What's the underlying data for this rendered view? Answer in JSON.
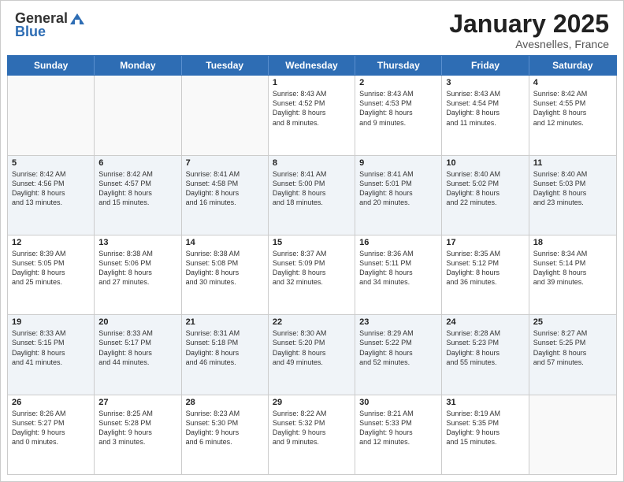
{
  "header": {
    "logo_general": "General",
    "logo_blue": "Blue",
    "month_title": "January 2025",
    "subtitle": "Avesnelles, France"
  },
  "days_of_week": [
    "Sunday",
    "Monday",
    "Tuesday",
    "Wednesday",
    "Thursday",
    "Friday",
    "Saturday"
  ],
  "rows": [
    {
      "alt": false,
      "cells": [
        {
          "day": "",
          "lines": []
        },
        {
          "day": "",
          "lines": []
        },
        {
          "day": "",
          "lines": []
        },
        {
          "day": "1",
          "lines": [
            "Sunrise: 8:43 AM",
            "Sunset: 4:52 PM",
            "Daylight: 8 hours",
            "and 8 minutes."
          ]
        },
        {
          "day": "2",
          "lines": [
            "Sunrise: 8:43 AM",
            "Sunset: 4:53 PM",
            "Daylight: 8 hours",
            "and 9 minutes."
          ]
        },
        {
          "day": "3",
          "lines": [
            "Sunrise: 8:43 AM",
            "Sunset: 4:54 PM",
            "Daylight: 8 hours",
            "and 11 minutes."
          ]
        },
        {
          "day": "4",
          "lines": [
            "Sunrise: 8:42 AM",
            "Sunset: 4:55 PM",
            "Daylight: 8 hours",
            "and 12 minutes."
          ]
        }
      ]
    },
    {
      "alt": true,
      "cells": [
        {
          "day": "5",
          "lines": [
            "Sunrise: 8:42 AM",
            "Sunset: 4:56 PM",
            "Daylight: 8 hours",
            "and 13 minutes."
          ]
        },
        {
          "day": "6",
          "lines": [
            "Sunrise: 8:42 AM",
            "Sunset: 4:57 PM",
            "Daylight: 8 hours",
            "and 15 minutes."
          ]
        },
        {
          "day": "7",
          "lines": [
            "Sunrise: 8:41 AM",
            "Sunset: 4:58 PM",
            "Daylight: 8 hours",
            "and 16 minutes."
          ]
        },
        {
          "day": "8",
          "lines": [
            "Sunrise: 8:41 AM",
            "Sunset: 5:00 PM",
            "Daylight: 8 hours",
            "and 18 minutes."
          ]
        },
        {
          "day": "9",
          "lines": [
            "Sunrise: 8:41 AM",
            "Sunset: 5:01 PM",
            "Daylight: 8 hours",
            "and 20 minutes."
          ]
        },
        {
          "day": "10",
          "lines": [
            "Sunrise: 8:40 AM",
            "Sunset: 5:02 PM",
            "Daylight: 8 hours",
            "and 22 minutes."
          ]
        },
        {
          "day": "11",
          "lines": [
            "Sunrise: 8:40 AM",
            "Sunset: 5:03 PM",
            "Daylight: 8 hours",
            "and 23 minutes."
          ]
        }
      ]
    },
    {
      "alt": false,
      "cells": [
        {
          "day": "12",
          "lines": [
            "Sunrise: 8:39 AM",
            "Sunset: 5:05 PM",
            "Daylight: 8 hours",
            "and 25 minutes."
          ]
        },
        {
          "day": "13",
          "lines": [
            "Sunrise: 8:38 AM",
            "Sunset: 5:06 PM",
            "Daylight: 8 hours",
            "and 27 minutes."
          ]
        },
        {
          "day": "14",
          "lines": [
            "Sunrise: 8:38 AM",
            "Sunset: 5:08 PM",
            "Daylight: 8 hours",
            "and 30 minutes."
          ]
        },
        {
          "day": "15",
          "lines": [
            "Sunrise: 8:37 AM",
            "Sunset: 5:09 PM",
            "Daylight: 8 hours",
            "and 32 minutes."
          ]
        },
        {
          "day": "16",
          "lines": [
            "Sunrise: 8:36 AM",
            "Sunset: 5:11 PM",
            "Daylight: 8 hours",
            "and 34 minutes."
          ]
        },
        {
          "day": "17",
          "lines": [
            "Sunrise: 8:35 AM",
            "Sunset: 5:12 PM",
            "Daylight: 8 hours",
            "and 36 minutes."
          ]
        },
        {
          "day": "18",
          "lines": [
            "Sunrise: 8:34 AM",
            "Sunset: 5:14 PM",
            "Daylight: 8 hours",
            "and 39 minutes."
          ]
        }
      ]
    },
    {
      "alt": true,
      "cells": [
        {
          "day": "19",
          "lines": [
            "Sunrise: 8:33 AM",
            "Sunset: 5:15 PM",
            "Daylight: 8 hours",
            "and 41 minutes."
          ]
        },
        {
          "day": "20",
          "lines": [
            "Sunrise: 8:33 AM",
            "Sunset: 5:17 PM",
            "Daylight: 8 hours",
            "and 44 minutes."
          ]
        },
        {
          "day": "21",
          "lines": [
            "Sunrise: 8:31 AM",
            "Sunset: 5:18 PM",
            "Daylight: 8 hours",
            "and 46 minutes."
          ]
        },
        {
          "day": "22",
          "lines": [
            "Sunrise: 8:30 AM",
            "Sunset: 5:20 PM",
            "Daylight: 8 hours",
            "and 49 minutes."
          ]
        },
        {
          "day": "23",
          "lines": [
            "Sunrise: 8:29 AM",
            "Sunset: 5:22 PM",
            "Daylight: 8 hours",
            "and 52 minutes."
          ]
        },
        {
          "day": "24",
          "lines": [
            "Sunrise: 8:28 AM",
            "Sunset: 5:23 PM",
            "Daylight: 8 hours",
            "and 55 minutes."
          ]
        },
        {
          "day": "25",
          "lines": [
            "Sunrise: 8:27 AM",
            "Sunset: 5:25 PM",
            "Daylight: 8 hours",
            "and 57 minutes."
          ]
        }
      ]
    },
    {
      "alt": false,
      "cells": [
        {
          "day": "26",
          "lines": [
            "Sunrise: 8:26 AM",
            "Sunset: 5:27 PM",
            "Daylight: 9 hours",
            "and 0 minutes."
          ]
        },
        {
          "day": "27",
          "lines": [
            "Sunrise: 8:25 AM",
            "Sunset: 5:28 PM",
            "Daylight: 9 hours",
            "and 3 minutes."
          ]
        },
        {
          "day": "28",
          "lines": [
            "Sunrise: 8:23 AM",
            "Sunset: 5:30 PM",
            "Daylight: 9 hours",
            "and 6 minutes."
          ]
        },
        {
          "day": "29",
          "lines": [
            "Sunrise: 8:22 AM",
            "Sunset: 5:32 PM",
            "Daylight: 9 hours",
            "and 9 minutes."
          ]
        },
        {
          "day": "30",
          "lines": [
            "Sunrise: 8:21 AM",
            "Sunset: 5:33 PM",
            "Daylight: 9 hours",
            "and 12 minutes."
          ]
        },
        {
          "day": "31",
          "lines": [
            "Sunrise: 8:19 AM",
            "Sunset: 5:35 PM",
            "Daylight: 9 hours",
            "and 15 minutes."
          ]
        },
        {
          "day": "",
          "lines": []
        }
      ]
    }
  ]
}
